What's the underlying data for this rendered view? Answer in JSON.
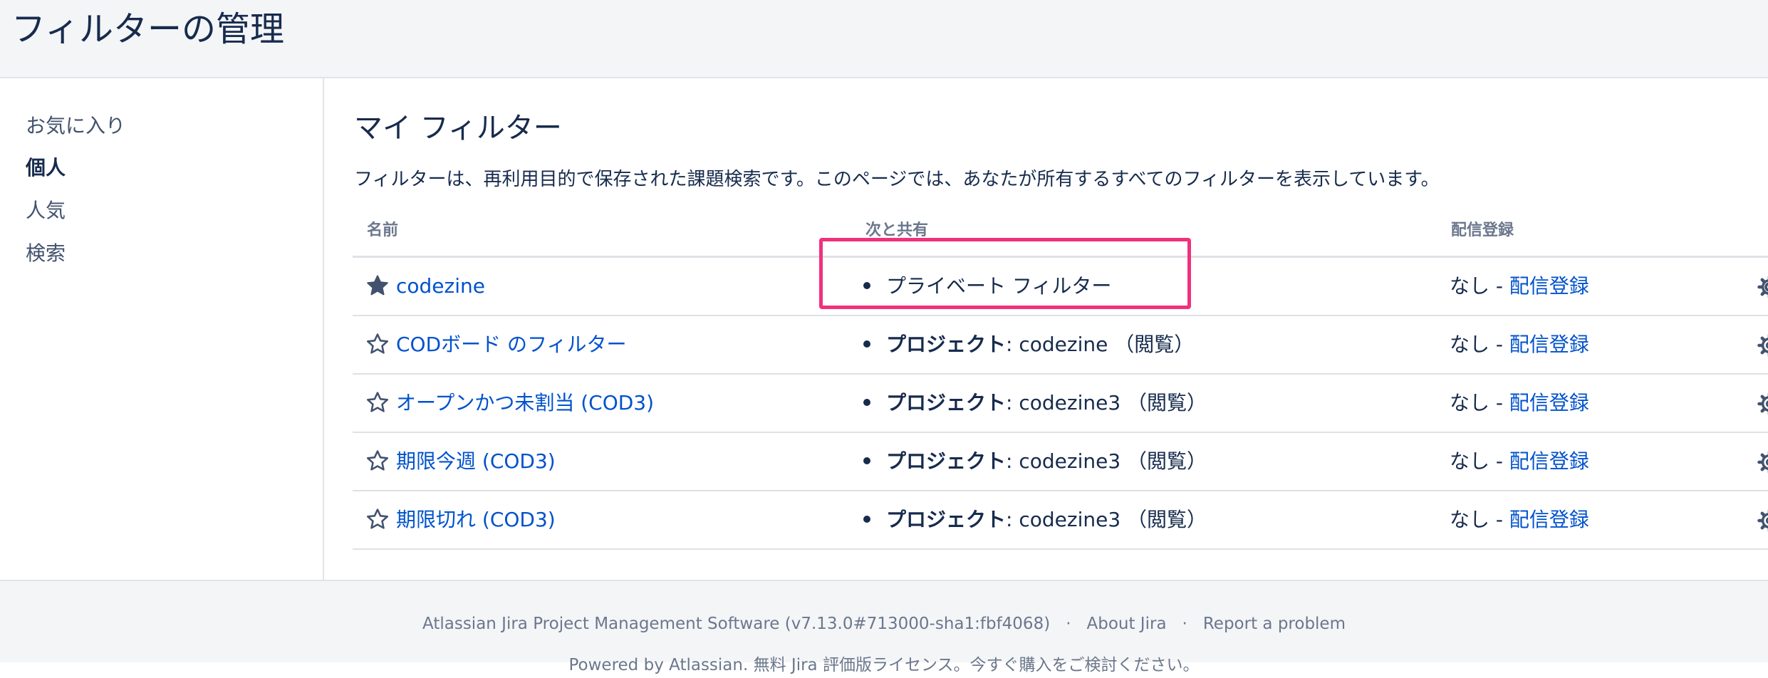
{
  "header": {
    "title": "フィルターの管理"
  },
  "sidebar": {
    "items": [
      {
        "label": "お気に入り"
      },
      {
        "label": "個人"
      },
      {
        "label": "人気"
      },
      {
        "label": "検索"
      }
    ],
    "active": "個人"
  },
  "main": {
    "section_title": "マイ フィルター",
    "description": "フィルターは、再利用目的で保存された課題検索です。このページでは、あなたが所有するすべてのフィルターを表示しています。",
    "columns": {
      "name": "名前",
      "shared_with": "次と共有",
      "subscriptions": "配信登録"
    },
    "filters": [
      {
        "name": "codezine",
        "favorite": true,
        "share_label": "",
        "share_text": "プライベート フィルター",
        "subscription_status": "なし - ",
        "subscription_link": "配信登録"
      },
      {
        "name": "CODボード のフィルター",
        "favorite": false,
        "share_label": "プロジェクト",
        "share_text": ": codezine （閲覧）",
        "subscription_status": "なし - ",
        "subscription_link": "配信登録"
      },
      {
        "name": "オープンかつ未割当 (COD3)",
        "favorite": false,
        "share_label": "プロジェクト",
        "share_text": ": codezine3 （閲覧）",
        "subscription_status": "なし - ",
        "subscription_link": "配信登録"
      },
      {
        "name": "期限今週 (COD3)",
        "favorite": false,
        "share_label": "プロジェクト",
        "share_text": ": codezine3 （閲覧）",
        "subscription_status": "なし - ",
        "subscription_link": "配信登録"
      },
      {
        "name": "期限切れ (COD3)",
        "favorite": false,
        "share_label": "プロジェクト",
        "share_text": ": codezine3 （閲覧）",
        "subscription_status": "なし - ",
        "subscription_link": "配信登録"
      }
    ]
  },
  "footer": {
    "version_text": "Atlassian Jira Project Management Software (v7.13.0#713000-sha1:fbf4068)",
    "separator": "·",
    "about_link": "About Jira",
    "report_link": "Report a problem",
    "powered_text": "Powered by Atlassian. 無料 Jira 評価版ライセンス。今すぐ購入をご検討ください。"
  },
  "colors": {
    "link": "#0052cc",
    "text": "#172b4d",
    "muted": "#6b778c",
    "highlight": "#f0317b",
    "header_bg": "#f4f5f7"
  },
  "icons": {
    "favorite_on": "star-filled-icon",
    "favorite_off": "star-outline-icon",
    "actions": "gear-icon"
  }
}
